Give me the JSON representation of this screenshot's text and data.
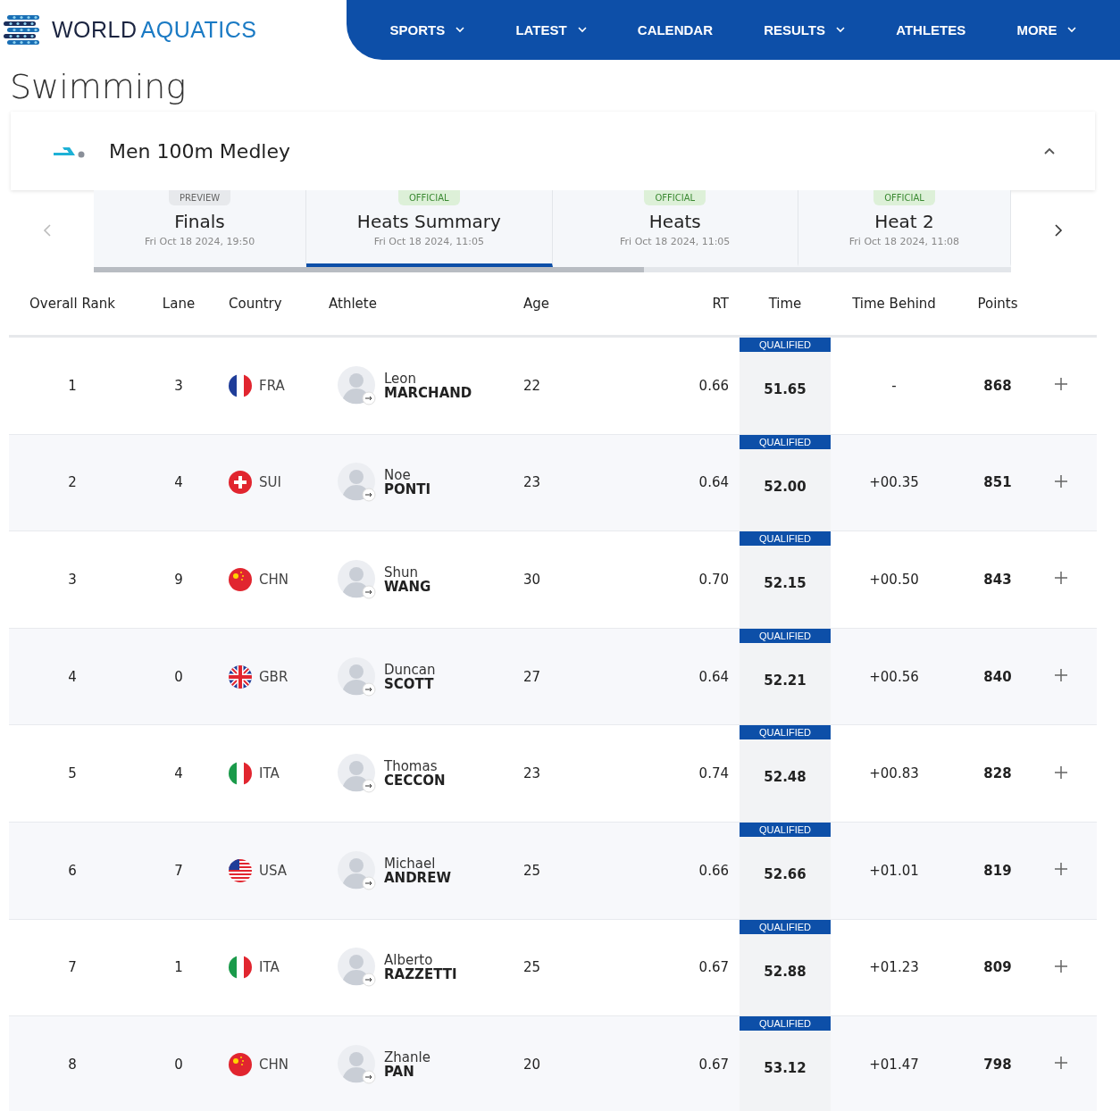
{
  "brand": {
    "word1": "WORLD",
    "word2": "AQUATICS"
  },
  "nav": [
    {
      "label": "SPORTS",
      "dropdown": true
    },
    {
      "label": "LATEST",
      "dropdown": true
    },
    {
      "label": "CALENDAR",
      "dropdown": false
    },
    {
      "label": "RESULTS",
      "dropdown": true
    },
    {
      "label": "ATHLETES",
      "dropdown": false
    },
    {
      "label": "MORE",
      "dropdown": true
    }
  ],
  "page_title": "Swimming",
  "event": {
    "title": "Men 100m Medley",
    "expanded": true
  },
  "tabs": [
    {
      "badge": "PREVIEW",
      "kind": "preview",
      "title": "Finals",
      "date": "Fri Oct 18 2024, 19:50",
      "selected": false
    },
    {
      "badge": "OFFICIAL",
      "kind": "official",
      "title": "Heats Summary",
      "date": "Fri Oct 18 2024, 11:05",
      "selected": true
    },
    {
      "badge": "OFFICIAL",
      "kind": "official",
      "title": "Heats",
      "date": "Fri Oct 18 2024, 11:05",
      "selected": false
    },
    {
      "badge": "OFFICIAL",
      "kind": "official",
      "title": "Heat 2",
      "date": "Fri Oct 18 2024, 11:08",
      "selected": false
    }
  ],
  "table": {
    "columns": [
      "Overall Rank",
      "Lane",
      "Country",
      "Athlete",
      "Age",
      "RT",
      "Time",
      "Time Behind",
      "Points"
    ],
    "rows": [
      {
        "rank": "1",
        "lane": "3",
        "kind": "fra",
        "country": "FRA",
        "first": "Leon",
        "last": "MARCHAND",
        "age": "22",
        "rt": "0.66",
        "status": "QUALIFIED",
        "time": "51.65",
        "behind": "-",
        "points": "868"
      },
      {
        "rank": "2",
        "lane": "4",
        "kind": "sui",
        "country": "SUI",
        "first": "Noe",
        "last": "PONTI",
        "age": "23",
        "rt": "0.64",
        "status": "QUALIFIED",
        "time": "52.00",
        "behind": "+00.35",
        "points": "851"
      },
      {
        "rank": "3",
        "lane": "9",
        "kind": "chn",
        "country": "CHN",
        "first": "Shun",
        "last": "WANG",
        "age": "30",
        "rt": "0.70",
        "status": "QUALIFIED",
        "time": "52.15",
        "behind": "+00.50",
        "points": "843"
      },
      {
        "rank": "4",
        "lane": "0",
        "kind": "gbr",
        "country": "GBR",
        "first": "Duncan",
        "last": "SCOTT",
        "age": "27",
        "rt": "0.64",
        "status": "QUALIFIED",
        "time": "52.21",
        "behind": "+00.56",
        "points": "840"
      },
      {
        "rank": "5",
        "lane": "4",
        "kind": "ita",
        "country": "ITA",
        "first": "Thomas",
        "last": "CECCON",
        "age": "23",
        "rt": "0.74",
        "status": "QUALIFIED",
        "time": "52.48",
        "behind": "+00.83",
        "points": "828"
      },
      {
        "rank": "6",
        "lane": "7",
        "kind": "usa",
        "country": "USA",
        "first": "Michael",
        "last": "ANDREW",
        "age": "25",
        "rt": "0.66",
        "status": "QUALIFIED",
        "time": "52.66",
        "behind": "+01.01",
        "points": "819"
      },
      {
        "rank": "7",
        "lane": "1",
        "kind": "ita",
        "country": "ITA",
        "first": "Alberto",
        "last": "RAZZETTI",
        "age": "25",
        "rt": "0.67",
        "status": "QUALIFIED",
        "time": "52.88",
        "behind": "+01.23",
        "points": "809"
      },
      {
        "rank": "8",
        "lane": "0",
        "kind": "chn",
        "country": "CHN",
        "first": "Zhanle",
        "last": "PAN",
        "age": "20",
        "rt": "0.67",
        "status": "QUALIFIED",
        "time": "53.12",
        "behind": "+01.47",
        "points": "798"
      }
    ]
  }
}
